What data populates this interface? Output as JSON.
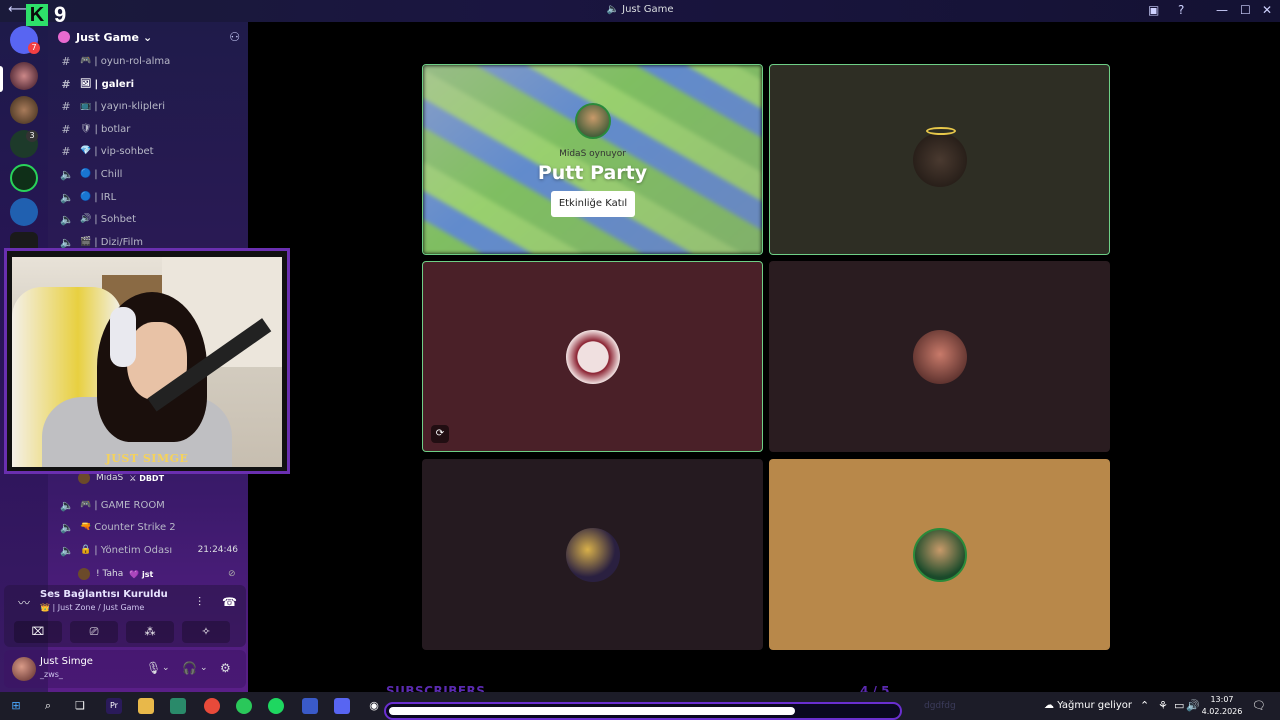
{
  "window": {
    "title": "Just Game",
    "logo_letter": "K",
    "logo_number": "9"
  },
  "rail": {
    "items": [
      {
        "name": "discord-home",
        "badge": "7"
      },
      {
        "name": "server-justgame",
        "badge": ""
      },
      {
        "name": "server-2",
        "badge": ""
      },
      {
        "name": "server-h",
        "badge": "3"
      },
      {
        "name": "server-green-h",
        "badge": ""
      },
      {
        "name": "server-mobile",
        "badge": ""
      },
      {
        "name": "server-just",
        "badge": ""
      }
    ]
  },
  "server": {
    "name": "Just Game",
    "dropdown": "⌄"
  },
  "channels": [
    {
      "type": "text",
      "emoji": "🎮",
      "label": "oyun-rol-alma",
      "active": false
    },
    {
      "type": "text",
      "emoji": "🖼",
      "label": "galeri",
      "active": true
    },
    {
      "type": "text",
      "emoji": "",
      "label": "yayın-klipleri",
      "active": false
    },
    {
      "type": "text",
      "emoji": "🛡",
      "label": "botlar",
      "active": false
    },
    {
      "type": "text",
      "emoji": "💎",
      "label": "vip-sohbet",
      "active": false
    },
    {
      "type": "voice",
      "emoji": "🔵",
      "label": "Chill",
      "active": false
    },
    {
      "type": "voice",
      "emoji": "🔵",
      "label": "IRL",
      "active": false
    },
    {
      "type": "voice",
      "emoji": "🔊",
      "label": "Sohbet",
      "active": false
    },
    {
      "type": "voice",
      "emoji": "🎬",
      "label": "Dizi/Film",
      "active": false
    }
  ],
  "lower_channels": {
    "sub_user_1": {
      "name": "MidaS",
      "tag": "DBDT"
    },
    "game_room": "GAME ROOM",
    "counter_strike": "Counter Strike 2",
    "yonetim": {
      "label": "Yönetim Odası",
      "time": "21:24:46"
    },
    "sub_user_2": {
      "name": "! Taha",
      "tag": "jst"
    }
  },
  "webcam": {
    "label": "JUST SIMGE"
  },
  "voice_panel": {
    "status": "Ses Bağlantısı Kuruldu",
    "location": "Just Zone / Just Game"
  },
  "user": {
    "name": "Just Simge",
    "status": "_zws_"
  },
  "stage": {
    "activity": {
      "host": "MidaS oynuyor",
      "name": "Putt Party",
      "join_label": "Etkinliğe Katıl"
    },
    "tiles": [
      {
        "name": "participant-halo",
        "bg": "#2e2e24",
        "speaking": true
      },
      {
        "name": "participant-santa",
        "bg": "#4a2028",
        "speaking": true
      },
      {
        "name": "participant-girl",
        "bg": "#2a1c20",
        "speaking": false
      },
      {
        "name": "participant-moon",
        "bg": "#251a20",
        "speaking": false
      },
      {
        "name": "participant-midas",
        "bg": "#b8884a",
        "speaking": false
      }
    ]
  },
  "overlay": {
    "subscribers_label": "SUBSCRIBERS",
    "subscribers_count": "4 / 5",
    "progress": 0.8
  },
  "taskbar": {
    "weather": "Yağmur geliyor",
    "time": "13:07",
    "date": "4.02.2026",
    "hidden_text": "dgdfdg"
  },
  "colors": {
    "accent": "#6ecf86",
    "brand_green": "#2ee06a",
    "purple": "#6a2fb0"
  }
}
